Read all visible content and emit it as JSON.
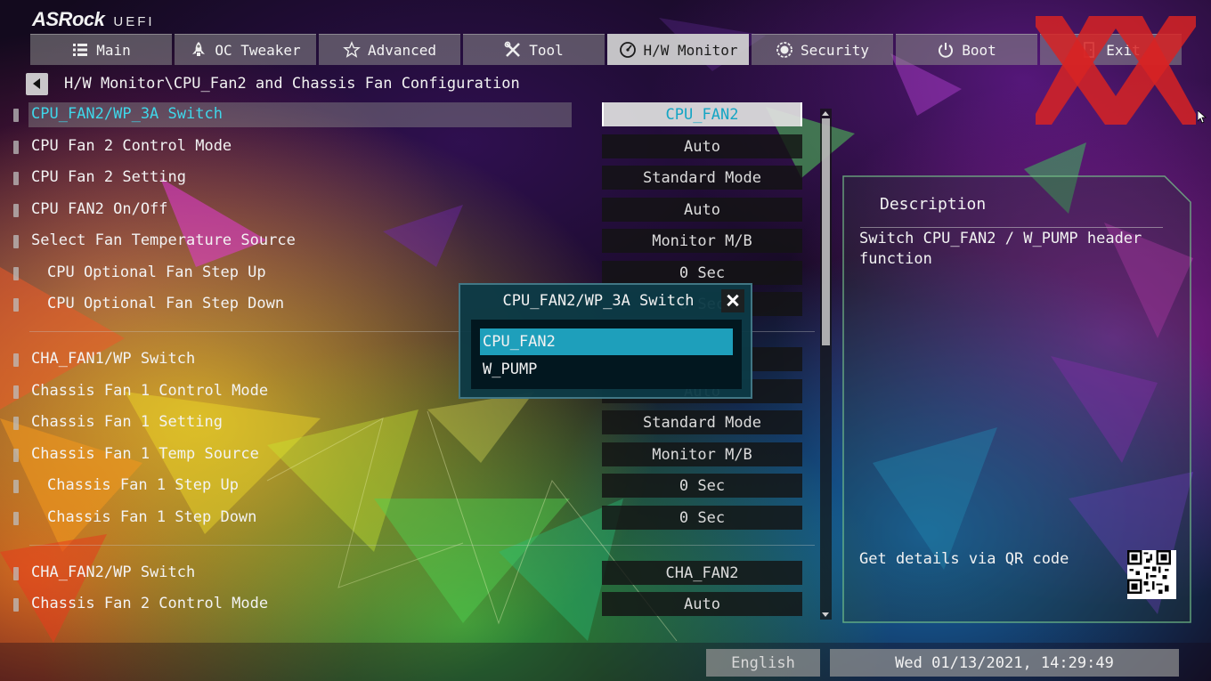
{
  "app": {
    "brand": "ASRock",
    "product": "UEFI"
  },
  "tabs": [
    {
      "label": "Main",
      "icon": "list-icon",
      "active": false
    },
    {
      "label": "OC Tweaker",
      "icon": "rocket-icon",
      "active": false
    },
    {
      "label": "Advanced",
      "icon": "star-icon",
      "active": false
    },
    {
      "label": "Tool",
      "icon": "wrench-screwdriver-icon",
      "active": false
    },
    {
      "label": "H/W Monitor",
      "icon": "gauge-icon",
      "active": true
    },
    {
      "label": "Security",
      "icon": "shield-icon",
      "active": false
    },
    {
      "label": "Boot",
      "icon": "power-icon",
      "active": false
    },
    {
      "label": "Exit",
      "icon": "exit-door-icon",
      "active": false
    }
  ],
  "breadcrumb": "H/W Monitor\\CPU_Fan2 and Chassis Fan Configuration",
  "settings": [
    {
      "label": "CPU_FAN2/WP_3A Switch",
      "value": "CPU_FAN2",
      "selected": true
    },
    {
      "label": "CPU Fan 2 Control Mode",
      "value": "Auto"
    },
    {
      "label": "CPU Fan 2 Setting",
      "value": "Standard Mode"
    },
    {
      "label": "CPU FAN2 On/Off",
      "value": "Auto"
    },
    {
      "label": "Select Fan Temperature Source",
      "value": "Monitor M/B"
    },
    {
      "label": "CPU Optional Fan Step Up",
      "value": "0 Sec",
      "indent": true
    },
    {
      "label": "CPU Optional Fan Step Down",
      "value": "0 Sec",
      "indent": true
    },
    {
      "label": "CHA_FAN1/WP Switch",
      "value": ""
    },
    {
      "label": "Chassis Fan 1 Control Mode",
      "value": "Auto"
    },
    {
      "label": "Chassis Fan 1 Setting",
      "value": "Standard Mode"
    },
    {
      "label": "Chassis Fan 1 Temp Source",
      "value": "Monitor M/B"
    },
    {
      "label": "Chassis Fan 1 Step Up",
      "value": "0 Sec",
      "indent": true
    },
    {
      "label": "Chassis Fan 1 Step Down",
      "value": "0 Sec",
      "indent": true
    },
    {
      "label": "CHA_FAN2/WP Switch",
      "value": "CHA_FAN2"
    },
    {
      "label": "Chassis Fan 2 Control Mode",
      "value": "Auto"
    }
  ],
  "description": {
    "title": "Description",
    "text": "Switch CPU_FAN2 / W_PUMP header\nfunction",
    "qr_label": "Get details via QR code"
  },
  "popup": {
    "title": "CPU_FAN2/WP_3A Switch",
    "options": [
      "CPU_FAN2",
      "W_PUMP"
    ],
    "selected_index": 0
  },
  "status": {
    "language": "English",
    "datetime": "Wed 01/13/2021, 14:29:49"
  },
  "colors": {
    "accent": "#3fd7ea",
    "popup_selected": "#1e9fbb",
    "watermark_red": "#d92626"
  }
}
